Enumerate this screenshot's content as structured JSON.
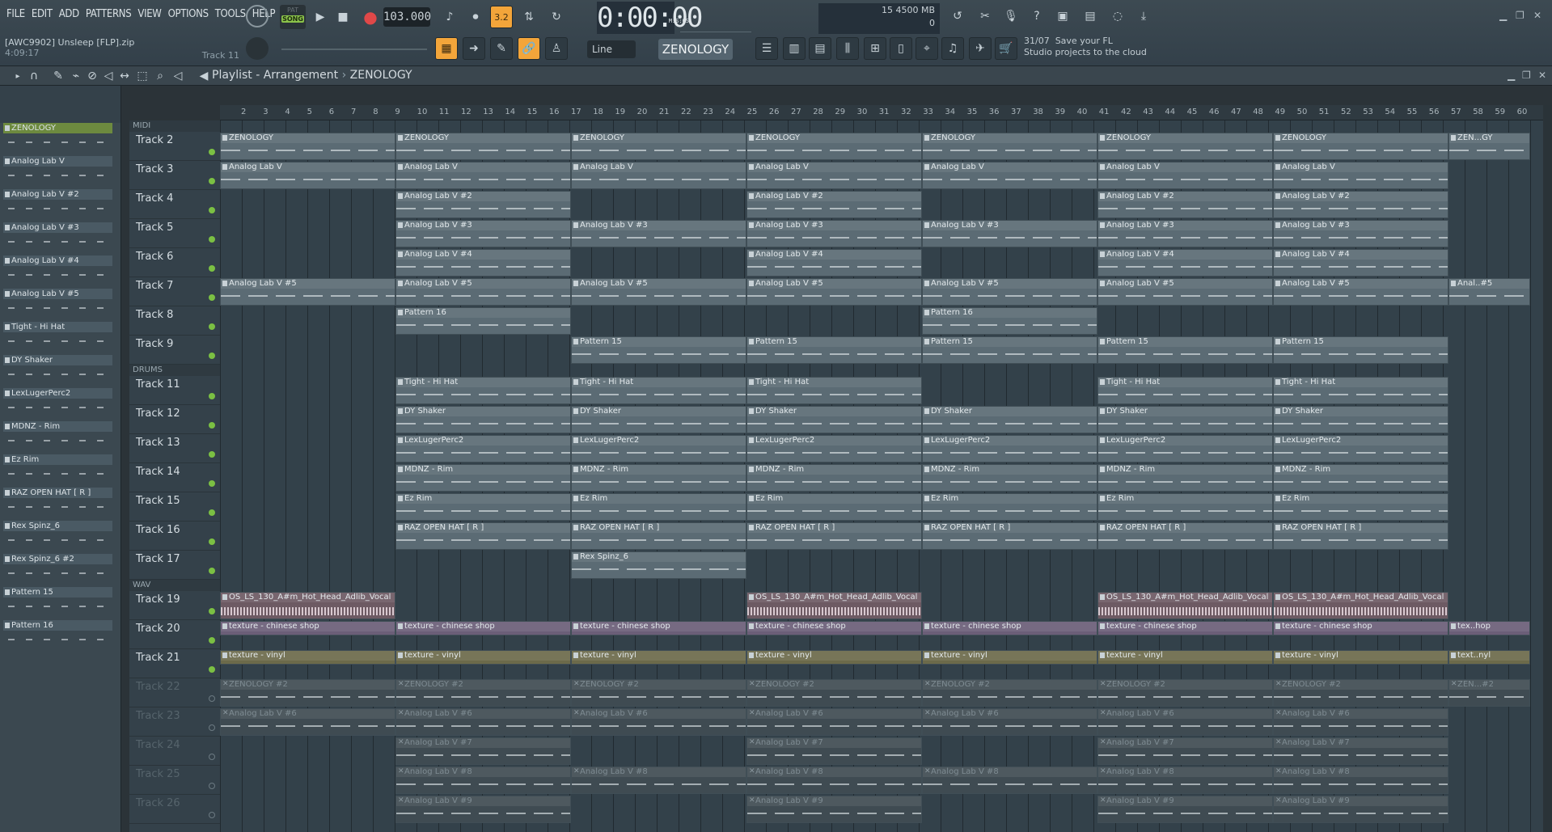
{
  "menu": [
    "FILE",
    "EDIT",
    "ADD",
    "PATTERNS",
    "VIEW",
    "OPTIONS",
    "TOOLS",
    "HELP"
  ],
  "transport": {
    "pat_label": "PAT",
    "song_label": "SONG",
    "tempo": "103.000",
    "time": "0:00:00",
    "time_unit": "M:S:CS",
    "step_label": "3.2"
  },
  "file": {
    "name": "[AWC9902] Unsleep [FLP].zip",
    "duration": "4:09:17",
    "track": "Track 11"
  },
  "cpu": {
    "a": "15",
    "mem": "4500 MB",
    "poly": "0"
  },
  "snap": "Line",
  "pattern_select": "ZENOLOGY",
  "news": {
    "date": "31/07",
    "line1": "Save your FL",
    "line2": "Studio projects to the cloud"
  },
  "playlist": {
    "title": "Playlist - Arrangement",
    "breadcrumb": "ZENOLOGY"
  },
  "picker": [
    "ZENOLOGY",
    "Analog Lab V",
    "Analog Lab V #2",
    "Analog Lab V #3",
    "Analog Lab V #4",
    "Analog Lab V #5",
    "Tight - Hi Hat",
    "DY Shaker",
    "LexLugerPerc2",
    "MDNZ - Rim",
    "Ez Rim",
    "RAZ OPEN HAT [ R ]",
    "Rex Spinz_6",
    "Rex Spinz_6 #2",
    "Pattern 15",
    "Pattern 16"
  ],
  "groups": [
    "MIDI",
    "DRUMS",
    "WAV"
  ],
  "tracks": {
    "midi": [
      "Track 2",
      "Track 3",
      "Track 4",
      "Track 5",
      "Track 6",
      "Track 7",
      "Track 8",
      "Track 9"
    ],
    "drums": [
      "Track 11",
      "Track 12",
      "Track 13",
      "Track 14",
      "Track 15",
      "Track 16",
      "Track 17"
    ],
    "wav": [
      "Track 19",
      "Track 20",
      "Track 21"
    ],
    "muted": [
      "Track 22",
      "Track 23",
      "Track 24",
      "Track 25",
      "Track 26"
    ]
  },
  "ruler": [
    "2",
    "3",
    "4",
    "5",
    "6",
    "7",
    "8",
    "9",
    "10",
    "11",
    "12",
    "13",
    "14",
    "15",
    "16",
    "17",
    "18",
    "19",
    "20",
    "21",
    "22",
    "23",
    "24",
    "25",
    "26",
    "27",
    "28",
    "29",
    "30",
    "31",
    "32",
    "33",
    "34",
    "35",
    "36",
    "37",
    "38",
    "39",
    "40",
    "41",
    "42",
    "43",
    "44",
    "45",
    "46",
    "47",
    "48",
    "49",
    "50",
    "51",
    "52",
    "53",
    "54",
    "55",
    "56",
    "57",
    "58",
    "59",
    "60"
  ],
  "clips": [
    {
      "row": 0,
      "label": "ZENOLOGY",
      "starts": [
        0,
        217,
        434,
        651,
        868,
        1085,
        1302,
        1519
      ],
      "width": 217,
      "last_label": "ZEN...GY"
    },
    {
      "row": 1,
      "label": "Analog Lab V",
      "starts": [
        0,
        217,
        434,
        651,
        868,
        1085,
        1302
      ],
      "width": 217
    },
    {
      "row": 2,
      "label": "Analog Lab V #2",
      "starts": [
        217,
        651,
        1085,
        1302
      ],
      "width": 217
    },
    {
      "row": 3,
      "label": "Analog Lab V #3",
      "starts": [
        217,
        434,
        651,
        868,
        1085,
        1302
      ],
      "width": 217
    },
    {
      "row": 4,
      "label": "Analog Lab V #4",
      "starts": [
        217,
        651,
        1085,
        1302
      ],
      "width": 217
    },
    {
      "row": 5,
      "label": "Analog Lab V #5",
      "starts": [
        0,
        217,
        434,
        651,
        868,
        1085,
        1302,
        1519
      ],
      "width": 217,
      "last_label": "Anal..#5"
    },
    {
      "row": 6,
      "label": "Pattern 16",
      "starts": [
        217,
        868
      ],
      "width": 217
    },
    {
      "row": 7,
      "label": "Pattern 15",
      "starts": [
        434,
        651,
        868,
        1085,
        1302
      ],
      "width": 217
    }
  ],
  "drum_clips": [
    {
      "label": "Tight - Hi Hat",
      "starts": [
        217,
        434,
        651,
        1085,
        1302
      ]
    },
    {
      "label": "DY Shaker",
      "starts": [
        217,
        434,
        651,
        868,
        1085,
        1302
      ]
    },
    {
      "label": "LexLugerPerc2",
      "starts": [
        217,
        434,
        651,
        868,
        1085,
        1302
      ]
    },
    {
      "label": "MDNZ - Rim",
      "starts": [
        217,
        434,
        651,
        868,
        1085,
        1302
      ]
    },
    {
      "label": "Ez Rim",
      "starts": [
        217,
        434,
        651,
        868,
        1085,
        1302
      ]
    },
    {
      "label": "RAZ OPEN HAT [ R ]",
      "starts": [
        217,
        434,
        651,
        868,
        1085,
        1302
      ]
    },
    {
      "label": "Rex Spinz_6",
      "starts": [
        434
      ]
    },
    {
      "label": "Rex Spinz_6 #2",
      "starts": [
        651,
        1085,
        1302
      ]
    }
  ],
  "wav_clips": [
    {
      "label": "OS_LS_130_A#m_Hot_Head_Adlib_Vocal",
      "starts": [
        0,
        651,
        1085,
        1302
      ]
    },
    {
      "label": "texture - chinese shop",
      "starts": [
        0,
        217,
        434,
        651,
        868,
        1085,
        1302
      ],
      "last_label": "tex..hop"
    },
    {
      "label": "texture - vinyl",
      "starts": [
        0,
        217,
        434,
        651,
        868,
        1085,
        1302
      ],
      "last_label": "text..nyl"
    }
  ],
  "muted_clips": [
    {
      "label": "ZENOLOGY #2",
      "starts": [
        0,
        217,
        434,
        651,
        868,
        1085,
        1302
      ],
      "last_label": "ZEN...#2"
    },
    {
      "label": "Analog Lab V #6",
      "starts": [
        0,
        217,
        434,
        651,
        868,
        1085,
        1302
      ]
    },
    {
      "label": "Analog Lab V #7",
      "starts": [
        217,
        651,
        1085,
        1302
      ]
    },
    {
      "label": "Analog Lab V #8",
      "starts": [
        217,
        434,
        651,
        868,
        1085,
        1302
      ]
    },
    {
      "label": "Analog Lab V #9",
      "starts": [
        217,
        651,
        1085,
        1302
      ]
    }
  ]
}
